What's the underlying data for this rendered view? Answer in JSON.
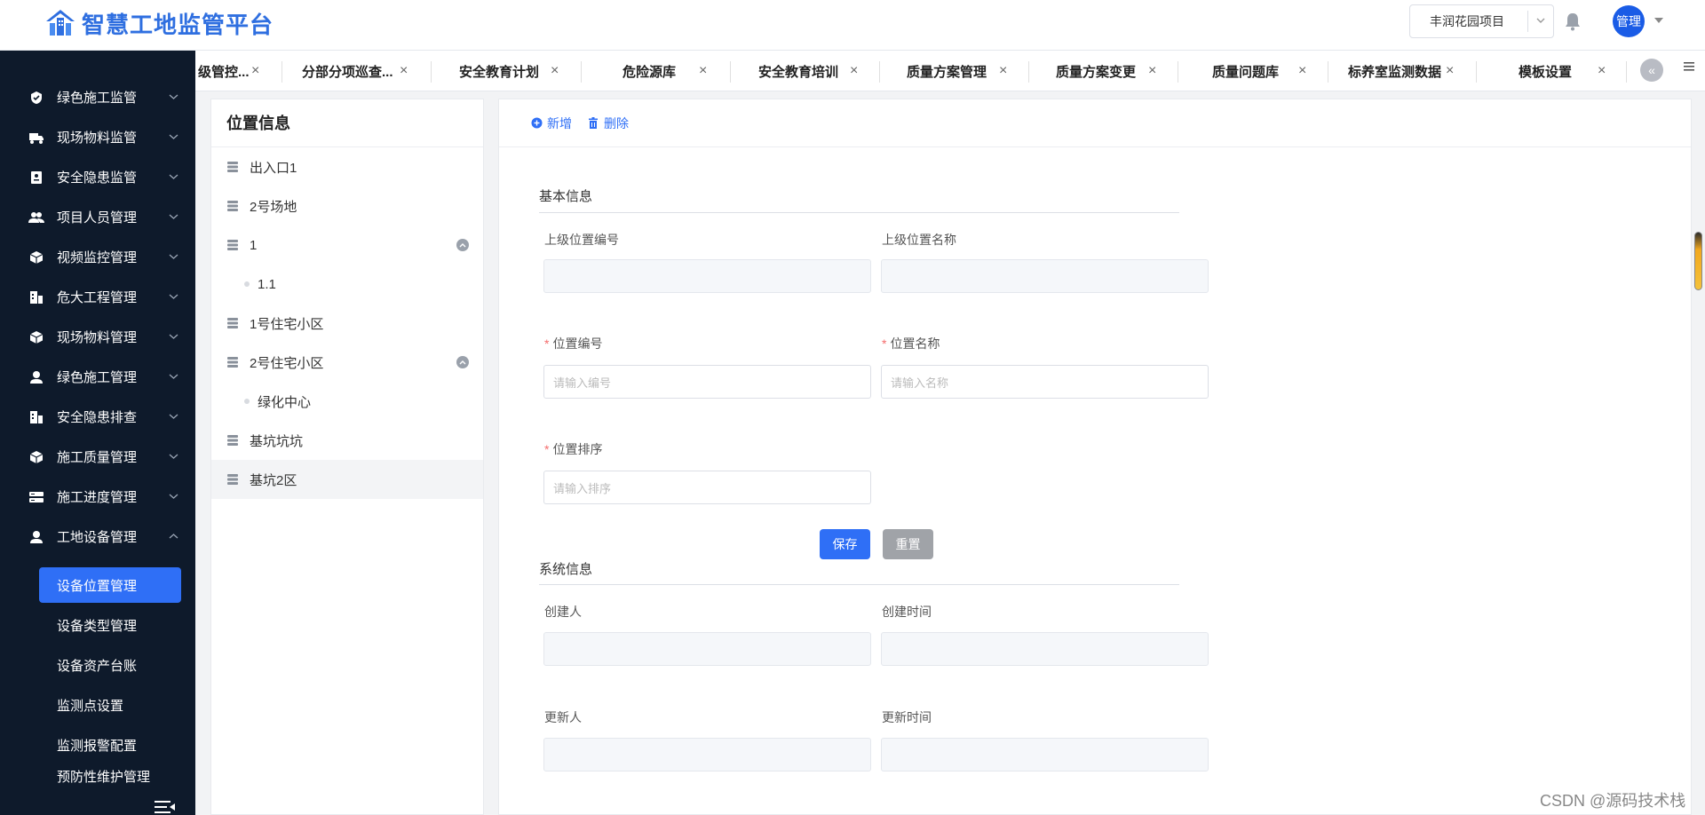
{
  "app": {
    "title": "智慧工地监管平台",
    "project_select": "丰润花园项目",
    "avatar_text": "管理"
  },
  "sidebar": {
    "menu": [
      {
        "label": "绿色施工监管",
        "icon": "leaf-shield-icon",
        "expanded": false
      },
      {
        "label": "现场物料监管",
        "icon": "truck-icon",
        "expanded": false
      },
      {
        "label": "安全隐患监管",
        "icon": "document-icon",
        "expanded": false
      },
      {
        "label": "项目人员管理",
        "icon": "users-icon",
        "expanded": false
      },
      {
        "label": "视频监控管理",
        "icon": "cube-icon",
        "expanded": false
      },
      {
        "label": "危大工程管理",
        "icon": "building-icon",
        "expanded": false
      },
      {
        "label": "现场物料管理",
        "icon": "cube-icon",
        "expanded": false
      },
      {
        "label": "绿色施工管理",
        "icon": "user-icon",
        "expanded": false
      },
      {
        "label": "安全隐患排查",
        "icon": "building-icon",
        "expanded": false
      },
      {
        "label": "施工质量管理",
        "icon": "cube-icon",
        "expanded": false
      },
      {
        "label": "施工进度管理",
        "icon": "server-icon",
        "expanded": false
      },
      {
        "label": "工地设备管理",
        "icon": "user-icon",
        "expanded": true
      }
    ],
    "submenu": [
      {
        "label": "设备位置管理",
        "active": true
      },
      {
        "label": "设备类型管理",
        "active": false
      },
      {
        "label": "设备资产台账",
        "active": false
      },
      {
        "label": "监测点设置",
        "active": false
      },
      {
        "label": "监测报警配置",
        "active": false
      },
      {
        "label": "预防性维护管理",
        "active": false
      }
    ]
  },
  "tabs": [
    {
      "label": "级管控...",
      "closable": true
    },
    {
      "label": "分部分项巡查...",
      "closable": true
    },
    {
      "label": "安全教育计划",
      "closable": true
    },
    {
      "label": "危险源库",
      "closable": true
    },
    {
      "label": "安全教育培训",
      "closable": true
    },
    {
      "label": "质量方案管理",
      "closable": true
    },
    {
      "label": "质量方案变更",
      "closable": true
    },
    {
      "label": "质量问题库",
      "closable": true
    },
    {
      "label": "标养室监测数据",
      "closable": true
    },
    {
      "label": "模板设置",
      "closable": true
    }
  ],
  "tab_scroll_label": "«",
  "location_panel": {
    "title": "位置信息",
    "nodes": [
      {
        "label": "出入口1",
        "level": 0,
        "toggle": false,
        "selected": false
      },
      {
        "label": "2号场地",
        "level": 0,
        "toggle": false,
        "selected": false
      },
      {
        "label": "1",
        "level": 0,
        "toggle": true,
        "selected": false
      },
      {
        "label": "1.1",
        "level": 1,
        "toggle": false,
        "selected": false
      },
      {
        "label": "1号住宅小区",
        "level": 0,
        "toggle": false,
        "selected": false
      },
      {
        "label": "2号住宅小区",
        "level": 0,
        "toggle": true,
        "selected": false
      },
      {
        "label": "绿化中心",
        "level": 1,
        "toggle": false,
        "selected": false
      },
      {
        "label": "基坑坑坑",
        "level": 0,
        "toggle": false,
        "selected": false
      },
      {
        "label": "基坑2区",
        "level": 0,
        "toggle": false,
        "selected": true
      }
    ]
  },
  "form": {
    "toolbar": {
      "add": "新增",
      "delete": "删除"
    },
    "basic_title": "基本信息",
    "parent_code_label": "上级位置编号",
    "parent_name_label": "上级位置名称",
    "code_label": "位置编号",
    "code_placeholder": "请输入编号",
    "name_label": "位置名称",
    "name_placeholder": "请输入名称",
    "sort_label": "位置排序",
    "sort_placeholder": "请输入排序",
    "save": "保存",
    "reset": "重置",
    "system_title": "系统信息",
    "creator_label": "创建人",
    "created_time_label": "创建时间",
    "updater_label": "更新人",
    "updated_time_label": "更新时间"
  },
  "watermark": "CSDN @源码技术栈",
  "colors": {
    "primary": "#2f6ff6",
    "sidebar_bg": "#0e1a2b",
    "required": "#f56c6c"
  }
}
